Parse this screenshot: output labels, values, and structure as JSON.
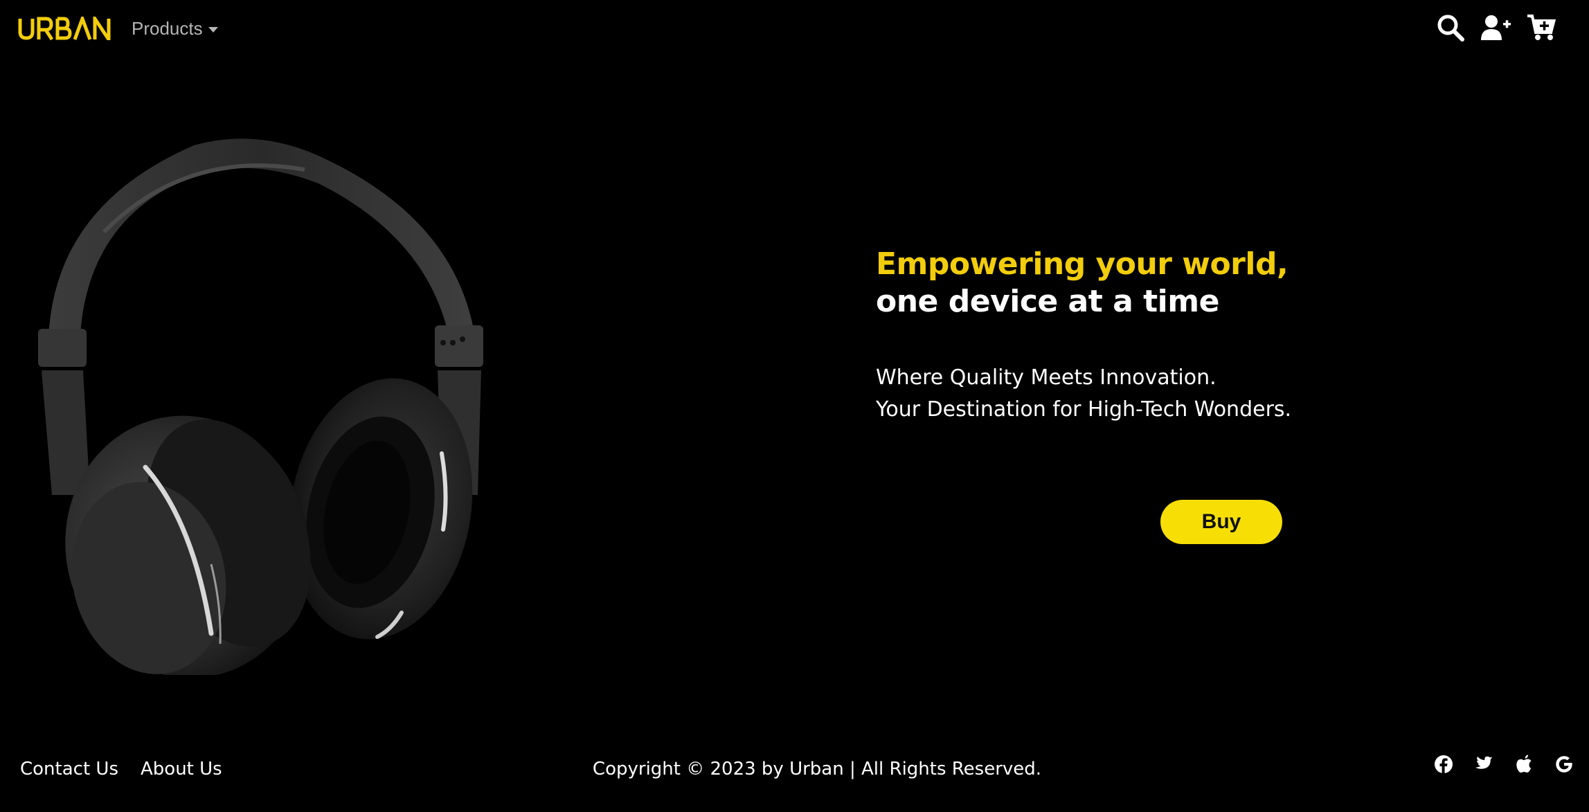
{
  "brand": {
    "name": "URBAN",
    "color": "#f2cd0b"
  },
  "nav": {
    "products_label": "Products",
    "icons": [
      "search-icon",
      "add-user-icon",
      "cart-add-icon"
    ]
  },
  "hero": {
    "headline_accent": "Empowering your world,",
    "headline_rest": " one device at a time",
    "subline_1": "Where Quality Meets Innovation.",
    "subline_2": "Your Destination for High-Tech Wonders.",
    "buy_label": "Buy",
    "image_subject": "headphones",
    "accent_color": "#f2cd0b",
    "button_color": "#f7df06"
  },
  "footer": {
    "contact_label": "Contact Us",
    "about_label": "About Us",
    "copyright": "Copyright © 2023 by Urban | All Rights Reserved.",
    "social_icons": [
      "facebook-icon",
      "twitter-icon",
      "apple-icon",
      "google-icon"
    ]
  }
}
